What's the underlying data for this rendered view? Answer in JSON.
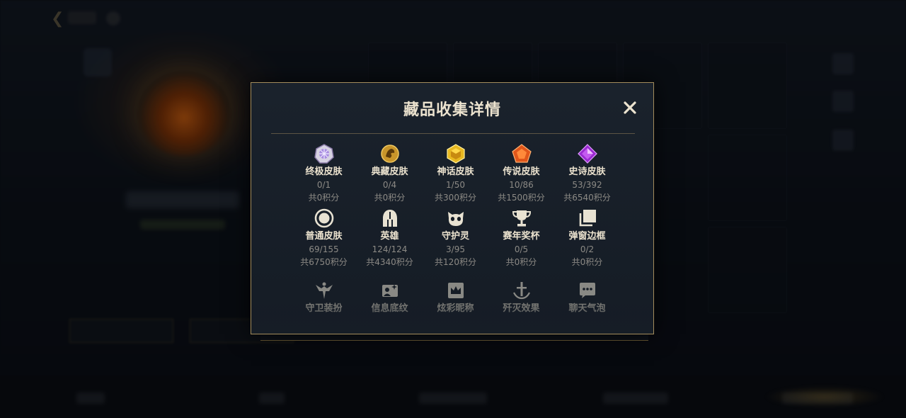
{
  "dialog": {
    "title": "藏品收集详情",
    "close_label": "✕",
    "items": [
      {
        "name": "终极皮肤",
        "count": "0/1",
        "points": "共0积分",
        "icon": "ultimate-skin-icon"
      },
      {
        "name": "典藏皮肤",
        "count": "0/4",
        "points": "共0积分",
        "icon": "prestige-skin-icon"
      },
      {
        "name": "神话皮肤",
        "count": "1/50",
        "points": "共300积分",
        "icon": "mythic-skin-icon"
      },
      {
        "name": "传说皮肤",
        "count": "10/86",
        "points": "共1500积分",
        "icon": "legendary-skin-icon"
      },
      {
        "name": "史诗皮肤",
        "count": "53/392",
        "points": "共6540积分",
        "icon": "epic-skin-icon"
      },
      {
        "name": "普通皮肤",
        "count": "69/155",
        "points": "共6750积分",
        "icon": "standard-skin-icon"
      },
      {
        "name": "英雄",
        "count": "124/124",
        "points": "共4340积分",
        "icon": "helmet-icon"
      },
      {
        "name": "守护灵",
        "count": "3/95",
        "points": "共120积分",
        "icon": "pet-icon"
      },
      {
        "name": "赛年奖杯",
        "count": "0/5",
        "points": "共0积分",
        "icon": "trophy-icon"
      },
      {
        "name": "弹窗边框",
        "count": "0/2",
        "points": "共0积分",
        "icon": "frame-icon"
      },
      {
        "name": "守卫装扮",
        "icon": "ward-icon"
      },
      {
        "name": "信息底纹",
        "icon": "card-icon"
      },
      {
        "name": "炫彩昵称",
        "icon": "crown-icon"
      },
      {
        "name": "歼灭效果",
        "icon": "sword-icon"
      },
      {
        "name": "聊天气泡",
        "icon": "chat-bubble-icon"
      }
    ]
  },
  "colors": {
    "gold_border": "#a38c5c",
    "title_text": "#ece3cf",
    "secondary_text": "#8c8a85"
  }
}
